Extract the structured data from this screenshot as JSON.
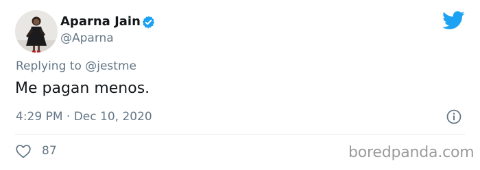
{
  "tweet": {
    "author": {
      "display_name": "Aparna Jain",
      "handle": "@Aparna",
      "verified": true
    },
    "reply": {
      "prefix": "Replying to",
      "mention": "@jestme"
    },
    "text": "Me pagan menos.",
    "meta": {
      "time": "4:29 PM",
      "separator": "·",
      "date": "Dec 10, 2020"
    },
    "likes": "87"
  },
  "watermark": "boredpanda.com",
  "colors": {
    "brand_blue": "#1da1f2",
    "secondary_text": "#657786",
    "primary_text": "#14171a",
    "divider": "#e1e8ed"
  },
  "icons": [
    "twitter-bird-icon",
    "verified-badge-icon",
    "info-icon",
    "heart-icon"
  ]
}
